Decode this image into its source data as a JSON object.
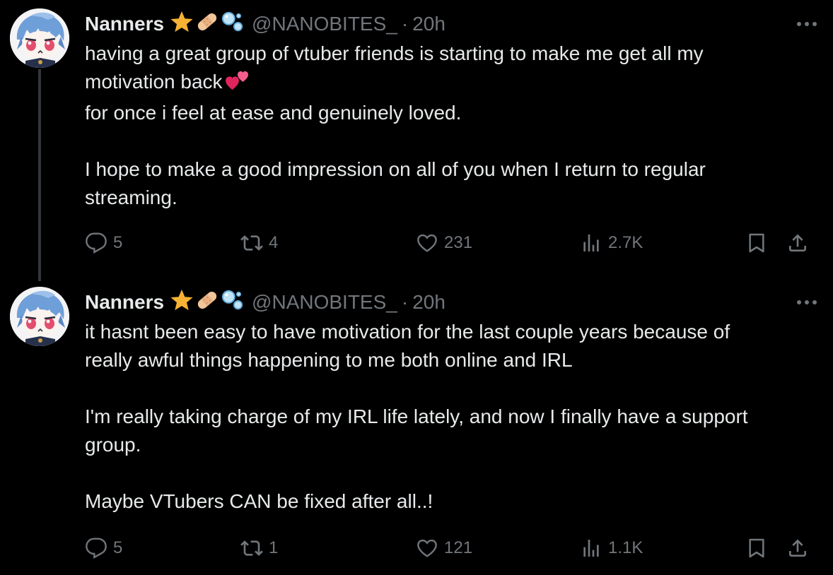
{
  "tweets": [
    {
      "author": {
        "name": "Nanners",
        "handle": "@NANOBITES_",
        "badges": [
          "star-emoji",
          "bandage-emoji",
          "bubbles-emoji"
        ]
      },
      "separator": "·",
      "time": "20h",
      "lines": [
        "having a great group of vtuber friends is starting to make me get all my",
        "motivation back",
        "for once i feel at ease and genuinely loved.",
        "",
        "I hope to make a good impression on all of you when I return to regular",
        "streaming."
      ],
      "inline_emoji": "two-hearts-emoji",
      "stats": {
        "replies": "5",
        "retweets": "4",
        "likes": "231",
        "views": "2.7K"
      }
    },
    {
      "author": {
        "name": "Nanners",
        "handle": "@NANOBITES_",
        "badges": [
          "star-emoji",
          "bandage-emoji",
          "bubbles-emoji"
        ]
      },
      "separator": "·",
      "time": "20h",
      "lines": [
        "it hasnt been easy to have motivation for the last couple years because of",
        "really awful things happening to me both online and IRL",
        "",
        "I'm really taking charge of my IRL life lately, and now I finally have a support",
        "group.",
        "",
        "Maybe VTubers CAN be fixed after all..!"
      ],
      "stats": {
        "replies": "5",
        "retweets": "1",
        "likes": "121",
        "views": "1.1K"
      }
    }
  ],
  "colors": {
    "background": "#000000",
    "text": "#e7e9ea",
    "secondary": "#71767b",
    "thread_line": "#333639"
  }
}
